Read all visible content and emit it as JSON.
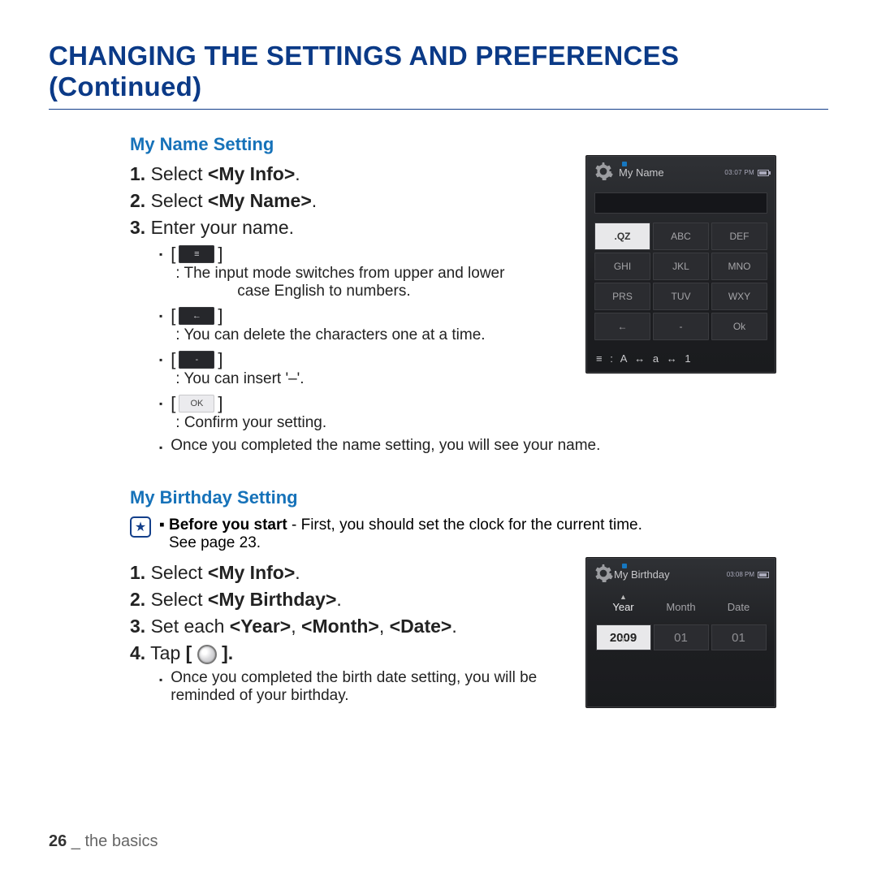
{
  "page": {
    "title": "CHANGING THE SETTINGS AND PREFERENCES (Continued)",
    "footer_page": "26",
    "footer_sep": " _ ",
    "footer_section": "the basics"
  },
  "name_section": {
    "heading": "My Name Setting",
    "step1_num": "1.",
    "step1_a": "Select ",
    "step1_b": "<My Info>",
    "step1_c": ".",
    "step2_num": "2.",
    "step2_a": "Select ",
    "step2_b": "<My Name>",
    "step2_c": ".",
    "step3_num": "3.",
    "step3_text": "Enter your name.",
    "bullet1_a": " : The input mode switches from upper and lower",
    "bullet1_b": "case English to numbers.",
    "bullet2": " : You can delete the characters one at a time.",
    "bullet3": " : You can insert '–'.",
    "bullet4_key": "OK",
    "bullet4": " : Confirm your setting.",
    "bullet5": "Once you completed the name setting, you will see your name."
  },
  "bd_section": {
    "heading": "My Birthday Setting",
    "note_b": "Before you start",
    "note_rest": " - First, you should set the clock for the current time.",
    "note_see": "See page 23.",
    "step1_num": "1.",
    "step1_a": "Select ",
    "step1_b": "<My Info>",
    "step1_c": ".",
    "step2_num": "2.",
    "step2_a": "Select ",
    "step2_b": "<My Birthday>",
    "step2_c": ".",
    "step3_num": "3.",
    "step3_a": "Set each ",
    "step3_b": "<Year>",
    "step3_c": ", ",
    "step3_d": "<Month>",
    "step3_e": ", ",
    "step3_f": "<Date>",
    "step3_g": ".",
    "step4_num": "4.",
    "step4_a": "Tap ",
    "step4_b": "[ ",
    "step4_c": " ].",
    "bullet1a": "Once you completed the birth date setting, you will be",
    "bullet1b": "reminded of your birthday."
  },
  "device_name": {
    "title": "My Name",
    "time": "03:07 PM",
    "keys": [
      [
        ".QZ",
        "ABC",
        "DEF"
      ],
      [
        "GHI",
        "JKL",
        "MNO"
      ],
      [
        "PRS",
        "TUV",
        "WXY"
      ],
      [
        "←",
        "-",
        "Ok"
      ]
    ],
    "modebar": "≡  : A  ↔  a  ↔  1"
  },
  "device_bd": {
    "title": "My Birthday",
    "time": "03:08 PM",
    "tabs": [
      "Year",
      "Month",
      "Date"
    ],
    "values": [
      "2009",
      "01",
      "01"
    ]
  }
}
